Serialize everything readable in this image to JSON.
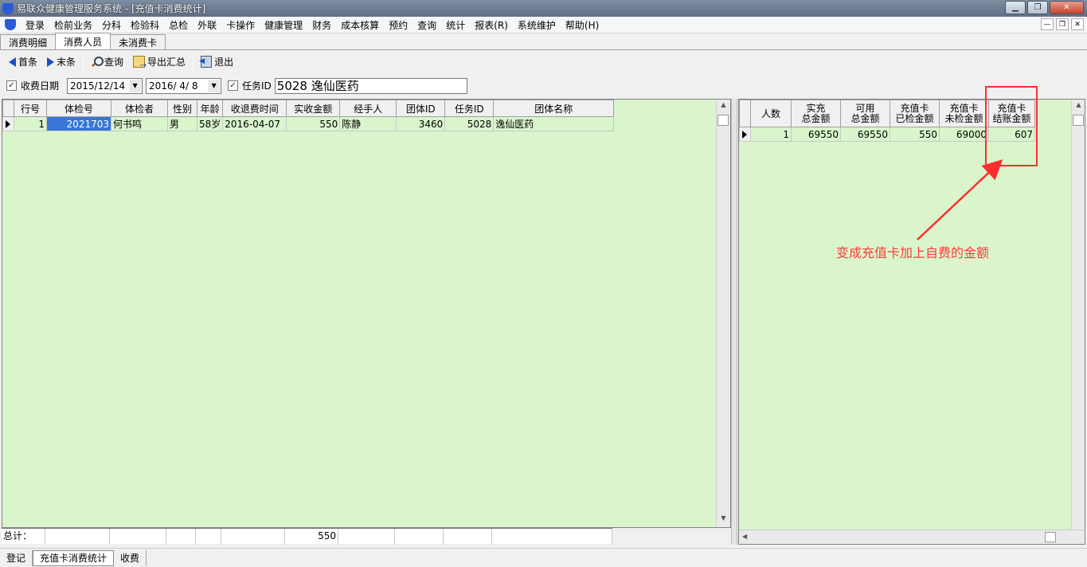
{
  "window": {
    "title": "易联众健康管理服务系统 - [充值卡消费统计]"
  },
  "window_buttons": [
    "▁",
    "❐",
    "✕"
  ],
  "menu": [
    "登录",
    "检前业务",
    "分科",
    "检验科",
    "总检",
    "外联",
    "卡操作",
    "健康管理",
    "财务",
    "成本核算",
    "预约",
    "查询",
    "统计",
    "报表(R)",
    "系统维护",
    "帮助(H)"
  ],
  "mdi_buttons": [
    "—",
    "❐",
    "✕"
  ],
  "tabs": [
    "消费明细",
    "消费人员",
    "未消费卡"
  ],
  "toolbar": {
    "first": "首条",
    "last": "末条",
    "query": "查询",
    "export": "导出汇总",
    "exit": "退出"
  },
  "filter": {
    "date_check": "✓",
    "date_label": "收费日期",
    "date_from": "2015/12/14",
    "date_to": "2016/ 4/ 8",
    "task_check": "✓",
    "task_label": "任务ID",
    "task_value": "5028 逸仙医药"
  },
  "left_grid": {
    "columns": [
      "行号",
      "体检号",
      "体检者",
      "性别",
      "年龄",
      "收退费时间",
      "实收金额",
      "经手人",
      "团体ID",
      "任务ID",
      "团体名称"
    ],
    "rows": [
      {
        "row_no": "1",
        "exam_no": "2021703",
        "name": "何书鸣",
        "gender": "男",
        "age": "58岁",
        "time": "2016-04-07",
        "amount": "550",
        "handler": "陈静",
        "group_id": "3460",
        "task_id": "5028",
        "group_name": "逸仙医药"
      }
    ],
    "total_label": "总计：",
    "total_amount": "550"
  },
  "right_grid": {
    "columns": [
      [
        "人数"
      ],
      [
        "实充",
        "总金额"
      ],
      [
        "可用",
        "总金额"
      ],
      [
        "充值卡",
        "已检金额"
      ],
      [
        "充值卡",
        "未检金额"
      ],
      [
        "充值卡",
        "结账金额"
      ]
    ],
    "rows": [
      {
        "count": "1",
        "charged_total": "69550",
        "available_total": "69550",
        "checked": "550",
        "unchecked": "69000",
        "settled": "607"
      }
    ]
  },
  "annotation": {
    "text": "变成充值卡加上自费的金额",
    "color": "#ff3a3a"
  },
  "status_tabs": [
    "登记",
    "充值卡消费统计",
    "收费"
  ],
  "colors": {
    "grid_bg": "#daf5cc",
    "selection": "#3876d6",
    "titlebar": "#6f7f94"
  }
}
